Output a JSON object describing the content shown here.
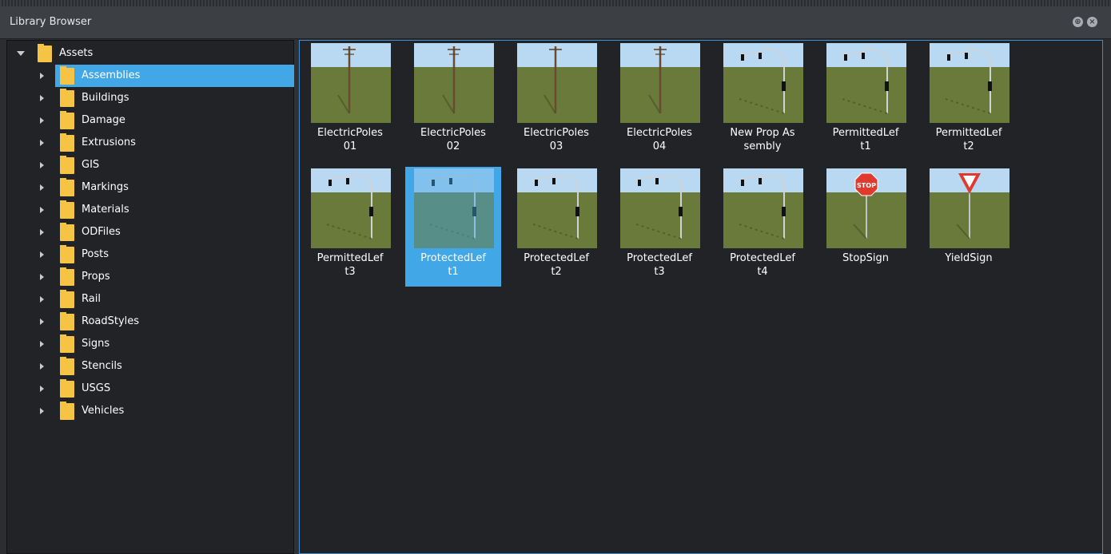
{
  "window": {
    "title": "Library Browser"
  },
  "tree": {
    "root": {
      "label": "Assets"
    },
    "items": [
      {
        "label": "Assemblies",
        "selected": true
      },
      {
        "label": "Buildings"
      },
      {
        "label": "Damage"
      },
      {
        "label": "Extrusions"
      },
      {
        "label": "GIS"
      },
      {
        "label": "Markings"
      },
      {
        "label": "Materials"
      },
      {
        "label": "ODFiles"
      },
      {
        "label": "Posts"
      },
      {
        "label": "Props"
      },
      {
        "label": "Rail"
      },
      {
        "label": "RoadStyles"
      },
      {
        "label": "Signs"
      },
      {
        "label": "Stencils"
      },
      {
        "label": "USGS"
      },
      {
        "label": "Vehicles"
      }
    ]
  },
  "assets": [
    {
      "line1": "ElectricPoles",
      "line2": "01",
      "icon": "electric-pole"
    },
    {
      "line1": "ElectricPoles",
      "line2": "02",
      "icon": "electric-pole"
    },
    {
      "line1": "ElectricPoles",
      "line2": "03",
      "icon": "electric-pole"
    },
    {
      "line1": "ElectricPoles",
      "line2": "04",
      "icon": "electric-pole"
    },
    {
      "line1": "New Prop As",
      "line2": "sembly",
      "icon": "traffic-signal"
    },
    {
      "line1": "PermittedLef",
      "line2": "t1",
      "icon": "traffic-signal"
    },
    {
      "line1": "PermittedLef",
      "line2": "t2",
      "icon": "traffic-signal"
    },
    {
      "line1": "PermittedLef",
      "line2": "t3",
      "icon": "traffic-signal"
    },
    {
      "line1": "ProtectedLef",
      "line2": "t1",
      "icon": "traffic-signal",
      "selected": true
    },
    {
      "line1": "ProtectedLef",
      "line2": "t2",
      "icon": "traffic-signal"
    },
    {
      "line1": "ProtectedLef",
      "line2": "t3",
      "icon": "traffic-signal"
    },
    {
      "line1": "ProtectedLef",
      "line2": "t4",
      "icon": "traffic-signal"
    },
    {
      "line1": "StopSign",
      "line2": "",
      "icon": "stop-sign",
      "sign_text": "STOP"
    },
    {
      "line1": "YieldSign",
      "line2": "",
      "icon": "yield-sign"
    }
  ],
  "colors": {
    "selection": "#41a7e6",
    "folder": "#f6c445",
    "sky": "#b9d8f2",
    "ground": "#6a7a3b"
  }
}
